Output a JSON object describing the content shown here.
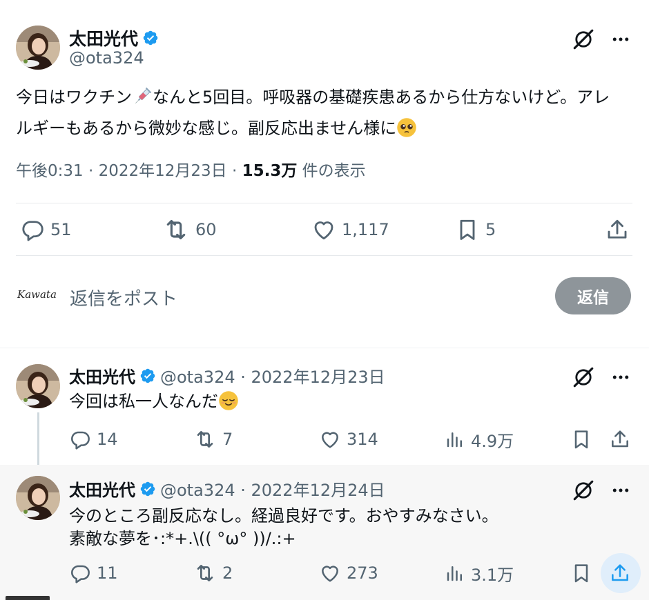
{
  "main_tweet": {
    "author_name": "太田光代",
    "handle": "@ota324",
    "text_part1": "今日はワクチン",
    "text_part2": "なんと5回目。呼吸器の基礎疾患あるから仕方ないけど。アレルギーもあるから微妙な感じ。副反応出ません様に",
    "emoji_1": "syringe-emoji",
    "emoji_2": "pleading-face-emoji",
    "time": "午後0:31",
    "separator": "·",
    "date": "2022年12月23日",
    "views_count": "15.3万",
    "views_label": "件の表示",
    "actions": {
      "reply_count": "51",
      "retweet_count": "60",
      "like_count": "1,117",
      "bookmark_count": "5"
    },
    "reply_placeholder": "返信をポスト",
    "reply_button": "返信",
    "composer_avatar_text": "Kawata"
  },
  "replies": [
    {
      "author_name": "太田光代",
      "handle_date": "@ota324 · 2022年12月23日",
      "text": "今回は私一人なんだ",
      "emoji": "relieved-face-emoji",
      "reply_count": "14",
      "retweet_count": "7",
      "like_count": "314",
      "views_count": "4.9万"
    },
    {
      "author_name": "太田光代",
      "handle_date": "@ota324 · 2022年12月24日",
      "text_line1": "今のところ副反応なし。経過良好です。おやすみなさい。",
      "text_line2": "素敵な夢を･:*+.\\(( °ω° ))/.:+",
      "reply_count": "11",
      "retweet_count": "2",
      "like_count": "273",
      "views_count": "3.1万"
    }
  ],
  "colors": {
    "text_primary": "#0f1419",
    "text_secondary": "#536471",
    "verified": "#1d9bf0",
    "reply_button_bg": "#8e959a",
    "highlight_row": "#f7f7f7",
    "share_highlight": "#e0eefb"
  }
}
